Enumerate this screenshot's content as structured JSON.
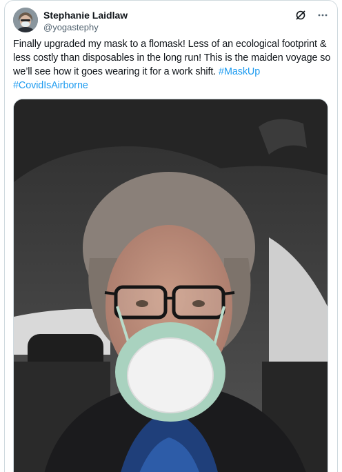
{
  "author": {
    "display_name": "Stephanie Laidlaw",
    "handle": "@yogastephy"
  },
  "header_icons": [
    "grok-slash-icon",
    "more-ellipsis-icon"
  ],
  "tweet": {
    "text_before_tags": "Finally upgraded my mask to a flomask! Less of an ecological footprint & less costly than disposables in the long run! This is the maiden voyage so we’ll see how it goes wearing it for a work shift.",
    "hashtag_1": "#MaskUp",
    "hashtag_2": "#CovidIsAirborne"
  },
  "colors": {
    "link": "#1d9bf0",
    "secondary_text": "#536471",
    "border": "#cfd9de",
    "mask": "#a9d2bf",
    "mask_filter": "#f2f2f2"
  }
}
